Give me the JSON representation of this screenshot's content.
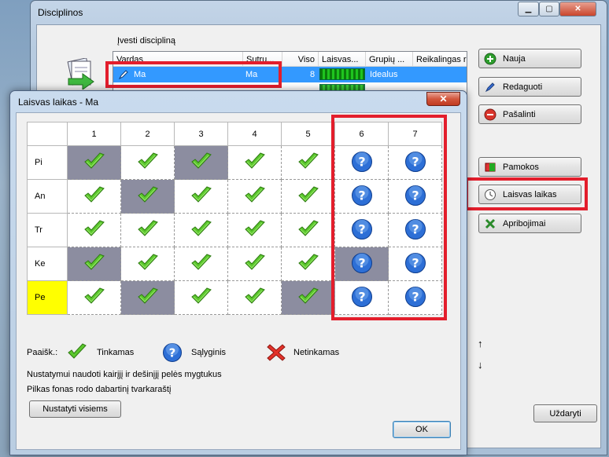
{
  "main_window": {
    "title": "Disciplinos",
    "enter_label": "Įvesti discipliną",
    "columns": [
      "Vardas",
      "Sutru...",
      "Viso",
      "Laisvas...",
      "Grupių ...",
      "Reikalingas r"
    ],
    "rows": [
      {
        "name": "Ma",
        "short": "Ma",
        "total": "8",
        "group": "Idealus"
      }
    ],
    "buttons": {
      "new": "Nauja",
      "edit": "Redaguoti",
      "delete": "Pašalinti",
      "lessons": "Pamokos",
      "free_time": "Laisvas laikas",
      "constraints": "Apribojimai",
      "close": "Uždaryti"
    }
  },
  "dialog": {
    "title": "Laisvas laikas - Ma",
    "columns": [
      "1",
      "2",
      "3",
      "4",
      "5",
      "6",
      "7"
    ],
    "highlight_column": "6",
    "days": [
      "Pi",
      "An",
      "Tr",
      "Ke",
      "Pe"
    ],
    "highlight_day": "Pe",
    "cells": [
      [
        "ok",
        "ok",
        "ok",
        "ok",
        "ok",
        "maybe",
        "maybe"
      ],
      [
        "ok",
        "ok",
        "ok",
        "ok",
        "ok",
        "maybe",
        "maybe"
      ],
      [
        "ok",
        "ok",
        "ok",
        "ok",
        "ok",
        "maybe",
        "maybe"
      ],
      [
        "ok",
        "ok",
        "ok",
        "ok",
        "ok",
        "maybe",
        "maybe"
      ],
      [
        "ok",
        "ok",
        "ok",
        "ok",
        "ok",
        "maybe",
        "maybe"
      ]
    ],
    "shaded": [
      [
        true,
        false,
        true,
        false,
        false,
        false,
        false
      ],
      [
        false,
        true,
        false,
        false,
        false,
        false,
        false
      ],
      [
        false,
        false,
        false,
        false,
        false,
        false,
        false
      ],
      [
        true,
        false,
        false,
        false,
        false,
        true,
        false
      ],
      [
        false,
        true,
        false,
        false,
        true,
        false,
        false
      ]
    ],
    "legend": {
      "prefix": "Paaišk.:",
      "ok": "Tinkamas",
      "maybe": "Sąlyginis",
      "no": "Netinkamas"
    },
    "info_line1": "Nustatymui naudoti kairįjį ir dešinįjį pelės mygtukus",
    "info_line2": "Pilkas fonas rodo dabartinį tvarkaraštį",
    "set_all_button": "Nustatyti visiems",
    "ok_button": "OK"
  },
  "colors": {
    "highlight": "#ffff00",
    "shaded": "#8c8da0",
    "annotation": "#e31e2c",
    "selection": "#3399ff"
  },
  "icons": {
    "ok": "green-check-icon",
    "maybe": "blue-question-icon",
    "no": "red-x-icon"
  }
}
